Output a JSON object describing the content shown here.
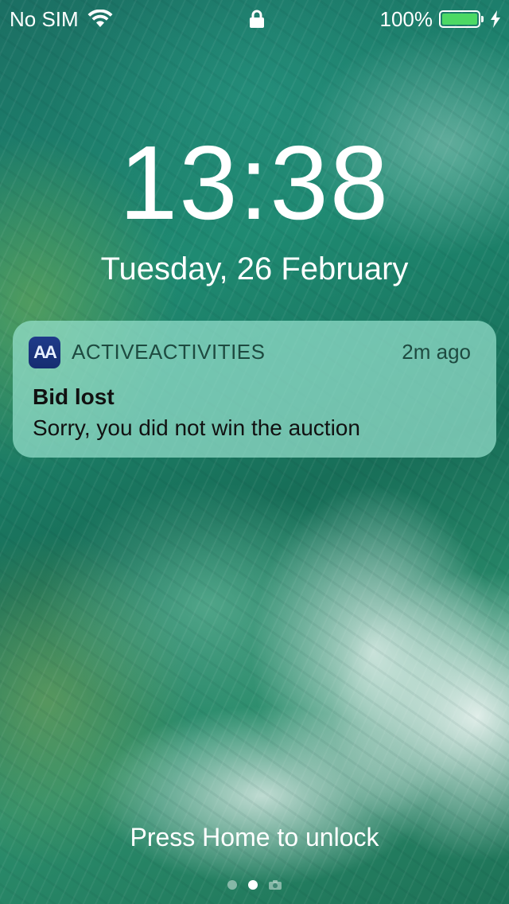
{
  "status_bar": {
    "carrier": "No SIM",
    "battery_percent": "100%",
    "battery_level": 1.0,
    "battery_color": "#4cd964",
    "icons": [
      "wifi-icon",
      "lock-icon",
      "battery-icon",
      "charging-bolt-icon"
    ]
  },
  "lock_screen": {
    "time": "13:38",
    "date": "Tuesday, 26 February",
    "unlock_hint": "Press Home to unlock",
    "page_indicator": {
      "pages": 3,
      "active_index": 1,
      "last_is_camera": true
    }
  },
  "notification": {
    "app_icon_text": "AA",
    "app_name": "ACTIVEACTIVITIES",
    "time_ago": "2m ago",
    "title": "Bid lost",
    "body": "Sorry, you did not win the auction"
  }
}
